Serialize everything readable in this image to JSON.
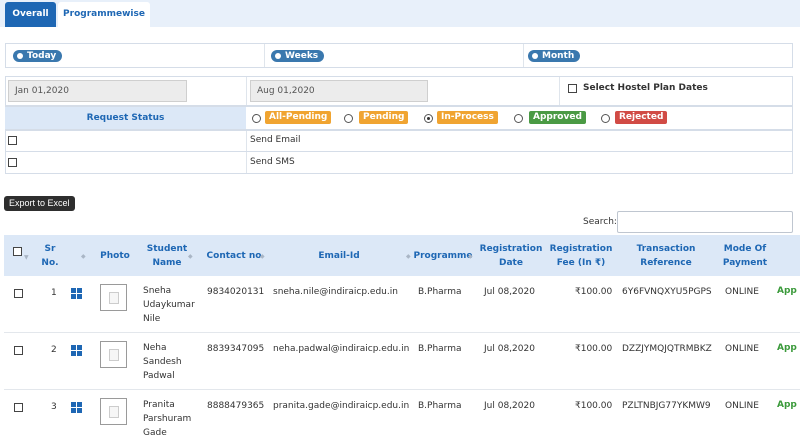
{
  "tabs": {
    "overall": "Overall",
    "programmewise": "Programmewise"
  },
  "period": {
    "today": "Today",
    "weeks": "Weeks",
    "month": "Month"
  },
  "dates": {
    "from": "Jan 01,2020",
    "to": "Aug 01,2020",
    "hostel_label": "Select Hostel Plan Dates"
  },
  "request_status": {
    "label": "Request Status",
    "options": [
      "All-Pending",
      "Pending",
      "In-Process",
      "Approved",
      "Rejected"
    ],
    "selected": "In-Process"
  },
  "notify": {
    "email": "Send Email",
    "sms": "Send SMS"
  },
  "export_label": "Export to Excel",
  "search": {
    "label": "Search:"
  },
  "columns": [
    "Sr No.",
    "Photo",
    "Student Name",
    "Contact no",
    "Email-Id",
    "Programme",
    "Registration Date",
    "Registration Fee (In ₹)",
    "Transaction Reference",
    "Mode Of Payment"
  ],
  "rows": [
    {
      "sr": "1",
      "name": [
        "Sneha",
        "Udaykumar",
        "Nile"
      ],
      "contact": "9834020131",
      "email": "sneha.nile@indiraicp.edu.in",
      "programme": "B.Pharma",
      "date": "Jul 08,2020",
      "fee": "₹100.00",
      "txn": "6Y6FVNQXYU5PGPS",
      "mode": "ONLINE",
      "status": "App"
    },
    {
      "sr": "2",
      "name": [
        "Neha",
        "Sandesh",
        "Padwal"
      ],
      "contact": "8839347095",
      "email": "neha.padwal@indiraicp.edu.in",
      "programme": "B.Pharma",
      "date": "Jul 08,2020",
      "fee": "₹100.00",
      "txn": "DZZJYMQJQTRMBKZ",
      "mode": "ONLINE",
      "status": "App"
    },
    {
      "sr": "3",
      "name": [
        "Pranita",
        "Parshuram",
        "Gade"
      ],
      "contact": "8888479365",
      "email": "pranita.gade@indiraicp.edu.in",
      "programme": "B.Pharma",
      "date": "Jul 08,2020",
      "fee": "₹100.00",
      "txn": "PZLTNBJG77YKMW9",
      "mode": "ONLINE",
      "status": "App"
    }
  ],
  "colors": {
    "accent": "#1e67b4",
    "all_pending": "#f0a431",
    "pending": "#f0a431",
    "in_process": "#f0a431",
    "approved": "#4a9a44",
    "rejected": "#d14b45"
  }
}
